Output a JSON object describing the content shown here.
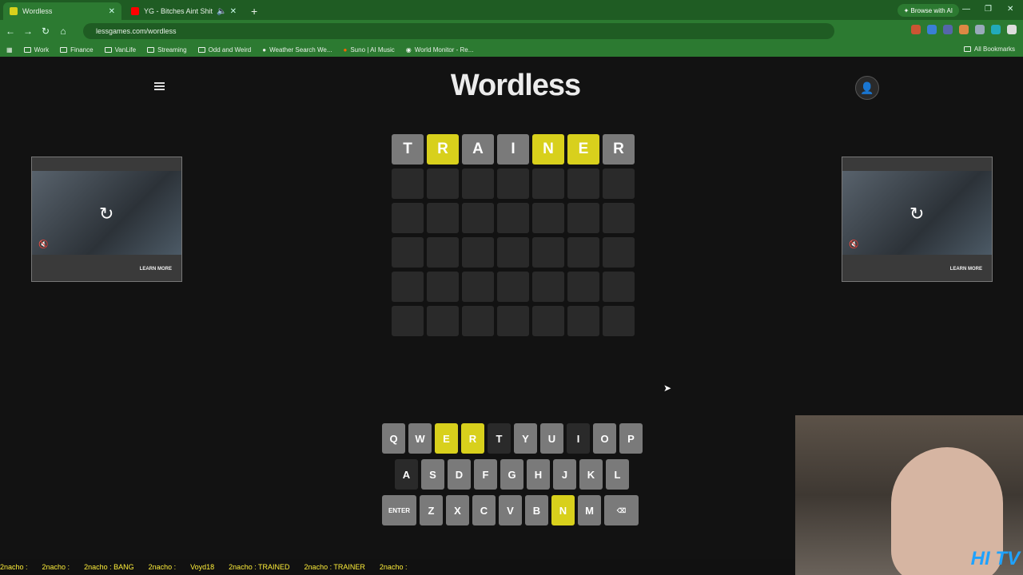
{
  "browser": {
    "tabs": [
      {
        "title": "Wordless",
        "active": true,
        "icon": "wordless-favicon",
        "color": "#d8d01c"
      },
      {
        "title": "YG - Bitches Aint Shit feat T",
        "active": false,
        "icon": "youtube-favicon",
        "color": "#ff0000"
      }
    ],
    "browse_ai": "Browse with AI",
    "url": "lessgames.com/wordless",
    "bookmarks": [
      "Work",
      "Finance",
      "VanLife",
      "Streaming",
      "Odd and Weird",
      "Weather Search We...",
      "Suno | AI Music",
      "World Monitor - Re..."
    ],
    "all_bookmarks": "All Bookmarks"
  },
  "page": {
    "logo": "Wordless",
    "board": [
      [
        {
          "l": "T",
          "s": "grey"
        },
        {
          "l": "R",
          "s": "yellow"
        },
        {
          "l": "A",
          "s": "grey"
        },
        {
          "l": "I",
          "s": "grey"
        },
        {
          "l": "N",
          "s": "yellow"
        },
        {
          "l": "E",
          "s": "yellow"
        },
        {
          "l": "R",
          "s": "grey"
        }
      ],
      [
        {
          "l": "",
          "s": "empty"
        },
        {
          "l": "",
          "s": "empty"
        },
        {
          "l": "",
          "s": "empty"
        },
        {
          "l": "",
          "s": "empty"
        },
        {
          "l": "",
          "s": "empty"
        },
        {
          "l": "",
          "s": "empty"
        },
        {
          "l": "",
          "s": "empty"
        }
      ],
      [
        {
          "l": "",
          "s": "empty"
        },
        {
          "l": "",
          "s": "empty"
        },
        {
          "l": "",
          "s": "empty"
        },
        {
          "l": "",
          "s": "empty"
        },
        {
          "l": "",
          "s": "empty"
        },
        {
          "l": "",
          "s": "empty"
        },
        {
          "l": "",
          "s": "empty"
        }
      ],
      [
        {
          "l": "",
          "s": "empty"
        },
        {
          "l": "",
          "s": "empty"
        },
        {
          "l": "",
          "s": "empty"
        },
        {
          "l": "",
          "s": "empty"
        },
        {
          "l": "",
          "s": "empty"
        },
        {
          "l": "",
          "s": "empty"
        },
        {
          "l": "",
          "s": "empty"
        }
      ],
      [
        {
          "l": "",
          "s": "empty"
        },
        {
          "l": "",
          "s": "empty"
        },
        {
          "l": "",
          "s": "empty"
        },
        {
          "l": "",
          "s": "empty"
        },
        {
          "l": "",
          "s": "empty"
        },
        {
          "l": "",
          "s": "empty"
        },
        {
          "l": "",
          "s": "empty"
        }
      ],
      [
        {
          "l": "",
          "s": "empty"
        },
        {
          "l": "",
          "s": "empty"
        },
        {
          "l": "",
          "s": "empty"
        },
        {
          "l": "",
          "s": "empty"
        },
        {
          "l": "",
          "s": "empty"
        },
        {
          "l": "",
          "s": "empty"
        },
        {
          "l": "",
          "s": "empty"
        }
      ]
    ],
    "keyboard": [
      [
        {
          "k": "Q",
          "s": "grey"
        },
        {
          "k": "W",
          "s": "grey"
        },
        {
          "k": "E",
          "s": "yellow"
        },
        {
          "k": "R",
          "s": "yellow"
        },
        {
          "k": "T",
          "s": "dark"
        },
        {
          "k": "Y",
          "s": "grey"
        },
        {
          "k": "U",
          "s": "grey"
        },
        {
          "k": "I",
          "s": "dark"
        },
        {
          "k": "O",
          "s": "grey"
        },
        {
          "k": "P",
          "s": "grey"
        }
      ],
      [
        {
          "k": "A",
          "s": "dark"
        },
        {
          "k": "S",
          "s": "grey"
        },
        {
          "k": "D",
          "s": "grey"
        },
        {
          "k": "F",
          "s": "grey"
        },
        {
          "k": "G",
          "s": "grey"
        },
        {
          "k": "H",
          "s": "grey"
        },
        {
          "k": "J",
          "s": "grey"
        },
        {
          "k": "K",
          "s": "grey"
        },
        {
          "k": "L",
          "s": "grey"
        }
      ],
      [
        {
          "k": "ENTER",
          "s": "grey",
          "wide": true
        },
        {
          "k": "Z",
          "s": "grey"
        },
        {
          "k": "X",
          "s": "grey"
        },
        {
          "k": "C",
          "s": "grey"
        },
        {
          "k": "V",
          "s": "grey"
        },
        {
          "k": "B",
          "s": "grey"
        },
        {
          "k": "N",
          "s": "yellow"
        },
        {
          "k": "M",
          "s": "grey"
        },
        {
          "k": "⌫",
          "s": "grey",
          "wide": true
        }
      ]
    ],
    "ads": [
      {
        "label": "LEARN MORE"
      },
      {
        "label": "LEARN MORE"
      }
    ]
  },
  "stream": {
    "ticker": [
      "2nacho :",
      "2nacho :",
      "2nacho : BANG",
      "2nacho :",
      "Voyd18",
      "2nacho : TRAINED",
      "2nacho : TRAINER",
      "2nacho :"
    ],
    "overlay": "HI TV"
  },
  "colors": {
    "present": "#d8d01c",
    "absent": "#7a7a7a",
    "empty": "#2a2a2a"
  }
}
